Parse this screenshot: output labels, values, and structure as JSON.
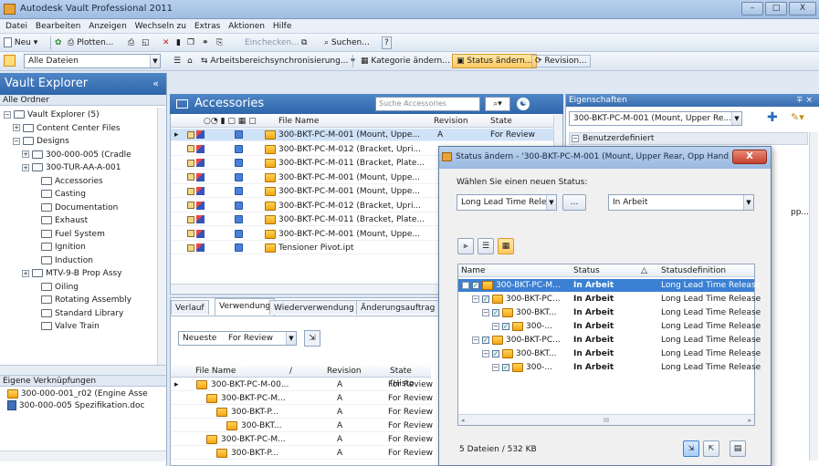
{
  "app": {
    "title": "Autodesk Vault Professional 2011",
    "window_controls": [
      "–",
      "□",
      "X"
    ]
  },
  "menu": [
    "Datei",
    "Bearbeiten",
    "Anzeigen",
    "Wechseln zu",
    "Extras",
    "Aktionen",
    "Hilfe"
  ],
  "toolbar1": {
    "new": "Neu",
    "plot": "Plotten...",
    "checkin": "Einchecken...",
    "search": "Suchen...",
    "help": "?"
  },
  "toolbar2": {
    "filter": "Alle Dateien",
    "sync": "Arbeitsbereichsynchronisierung...",
    "category": "Kategorie ändern...",
    "status": "Status ändern...",
    "revision": "Revision..."
  },
  "vault": {
    "title": "Vault Explorer",
    "collapse": "«",
    "section": "Alle Ordner",
    "tree": [
      {
        "label": "Vault Explorer (5)",
        "depth": 0,
        "exp": "−"
      },
      {
        "label": "Content Center Files",
        "depth": 1,
        "exp": "+"
      },
      {
        "label": "Designs",
        "depth": 1,
        "exp": "−"
      },
      {
        "label": "300-000-005 (Cradle",
        "depth": 2,
        "exp": "+"
      },
      {
        "label": "300-TUR-AA-A-001",
        "depth": 2,
        "exp": "+"
      },
      {
        "label": "Accessories",
        "depth": 3,
        "exp": ""
      },
      {
        "label": "Casting",
        "depth": 3,
        "exp": ""
      },
      {
        "label": "Documentation",
        "depth": 3,
        "exp": ""
      },
      {
        "label": "Exhaust",
        "depth": 3,
        "exp": ""
      },
      {
        "label": "Fuel System",
        "depth": 3,
        "exp": ""
      },
      {
        "label": "Ignition",
        "depth": 3,
        "exp": ""
      },
      {
        "label": "Induction",
        "depth": 3,
        "exp": ""
      },
      {
        "label": "MTV-9-B Prop Assy",
        "depth": 2,
        "exp": "+"
      },
      {
        "label": "Oiling",
        "depth": 3,
        "exp": ""
      },
      {
        "label": "Rotating Assembly",
        "depth": 3,
        "exp": ""
      },
      {
        "label": "Standard Library",
        "depth": 3,
        "exp": ""
      },
      {
        "label": "Valve Train",
        "depth": 3,
        "exp": ""
      }
    ],
    "shortcuts_title": "Eigene Verknüpfungen",
    "shortcuts": [
      "300-000-001_r02 (Engine Asse",
      "300-000-005 Spezifikation.doc"
    ]
  },
  "accessories": {
    "title": "Accessories",
    "search_placeholder": "Suche Accessories",
    "columns": {
      "name": "File Name",
      "revision": "Revision",
      "state": "State"
    },
    "rows": [
      {
        "name": "300-BKT-PC-M-001 (Mount, Uppe...",
        "revision": "A",
        "state": "For Review",
        "selected": true
      },
      {
        "name": "300-BKT-PC-M-012 (Bracket, Upri...",
        "revision": "",
        "state": ""
      },
      {
        "name": "300-BKT-PC-M-011 (Bracket, Plate...",
        "revision": "",
        "state": ""
      },
      {
        "name": "300-BKT-PC-M-001 (Mount, Uppe...",
        "revision": "",
        "state": ""
      },
      {
        "name": "300-BKT-PC-M-001 (Mount, Uppe...",
        "revision": "",
        "state": ""
      },
      {
        "name": "300-BKT-PC-M-012 (Bracket, Upri...",
        "revision": "",
        "state": ""
      },
      {
        "name": "300-BKT-PC-M-011 (Bracket, Plate...",
        "revision": "",
        "state": ""
      },
      {
        "name": "300-BKT-PC-M-001 (Mount, Uppe...",
        "revision": "",
        "state": ""
      },
      {
        "name": "Tensioner Pivot.ipt",
        "revision": "",
        "state": ""
      }
    ]
  },
  "history": {
    "tabs": [
      "Verlauf",
      "Verwendung",
      "Wiederverwendung",
      "Änderungsauftrag"
    ],
    "filter1": "Neueste",
    "filter2": "For Review",
    "columns": {
      "name": "File Name",
      "sort": "/",
      "revision": "Revision",
      "state": "State (Histo"
    },
    "rows": [
      {
        "name": "300-BKT-PC-M-00...",
        "depth": 0,
        "revision": "A",
        "state": "For Review"
      },
      {
        "name": "300-BKT-PC-M...",
        "depth": 1,
        "revision": "A",
        "state": "For Review"
      },
      {
        "name": "300-BKT-P...",
        "depth": 2,
        "revision": "A",
        "state": "For Review"
      },
      {
        "name": "300-BKT...",
        "depth": 3,
        "revision": "A",
        "state": "For Review"
      },
      {
        "name": "300-BKT-PC-M...",
        "depth": 1,
        "revision": "A",
        "state": "For Review"
      },
      {
        "name": "300-BKT-P...",
        "depth": 2,
        "revision": "A",
        "state": "For Review"
      }
    ]
  },
  "props": {
    "title": "Eigenschaften",
    "pin": "∓ ×",
    "selector": "300-BKT-PC-M-001 (Mount, Upper Re...",
    "group": "Benutzerdefiniert",
    "clip": "pp..."
  },
  "dialog": {
    "title": "Status ändern - '300-BKT-PC-M-001 (Mount, Upper Rear, Opp Hand)...",
    "close": "X",
    "prompt": "Wählen Sie einen neuen Status:",
    "lifecycle": "Long Lead Time Releas...",
    "ellipsis": "...",
    "state": "In Arbeit",
    "columns": {
      "name": "Name",
      "status": "Status",
      "warn": "△",
      "def": "Statusdefinition"
    },
    "rows": [
      {
        "name": "300-BKT-PC-M...",
        "depth": 0,
        "status": "In Arbeit",
        "def": "Long Lead Time Release",
        "selected": true
      },
      {
        "name": "300-BKT-PC...",
        "depth": 1,
        "status": "In Arbeit",
        "def": "Long Lead Time Release"
      },
      {
        "name": "300-BKT...",
        "depth": 2,
        "status": "In Arbeit",
        "def": "Long Lead Time Release"
      },
      {
        "name": "300-...",
        "depth": 3,
        "status": "In Arbeit",
        "def": "Long Lead Time Release"
      },
      {
        "name": "300-BKT-PC...",
        "depth": 1,
        "status": "In Arbeit",
        "def": "Long Lead Time Release"
      },
      {
        "name": "300-BKT...",
        "depth": 2,
        "status": "In Arbeit",
        "def": "Long Lead Time Release"
      },
      {
        "name": "300-...",
        "depth": 3,
        "status": "In Arbeit",
        "def": "Long Lead Time Release"
      }
    ],
    "footer": "5 Dateien / 532 KB",
    "hscroll_thumb": "III"
  },
  "colors": {
    "accent": "#2f66ab",
    "highlight": "#ffc861",
    "selection": "#3b80d2"
  }
}
